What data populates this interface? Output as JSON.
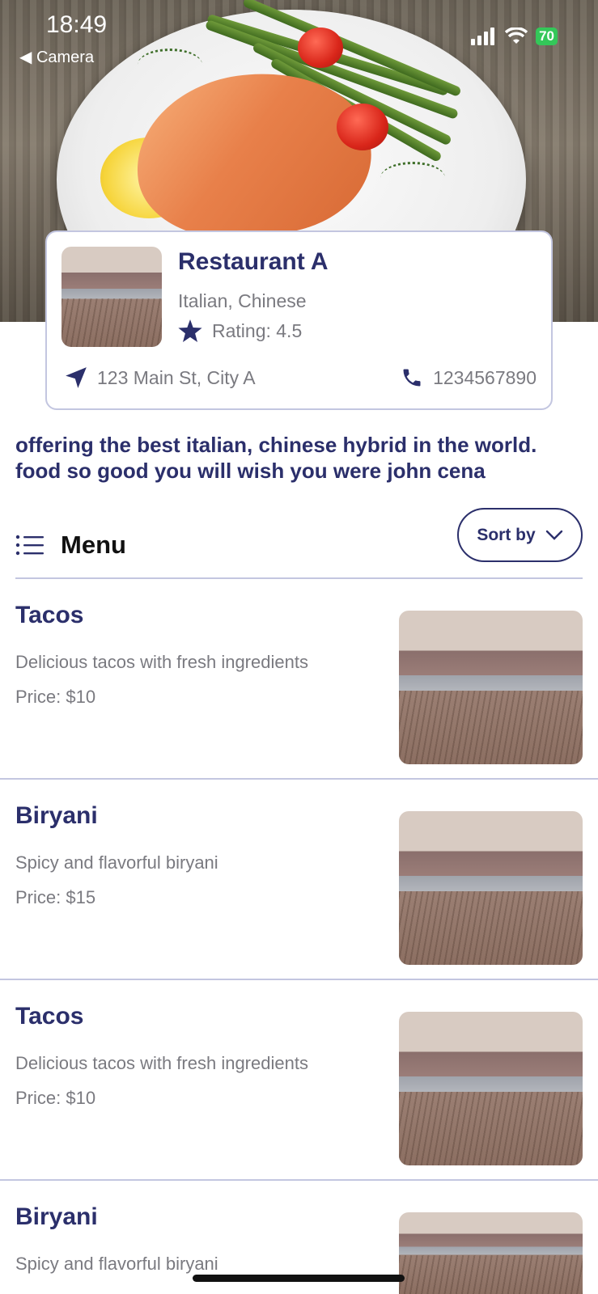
{
  "status_bar": {
    "time": "18:49",
    "back_label": "Camera",
    "battery": "70"
  },
  "restaurant": {
    "name": "Restaurant A",
    "cuisine": "Italian, Chinese",
    "rating": "Rating: 4.5",
    "address": "123 Main St, City A",
    "phone": "1234567890"
  },
  "description": "offering the best italian, chinese hybrid in the world. food so good you will wish you were john cena",
  "menu": {
    "title": "Menu",
    "sort_label": "Sort by"
  },
  "menu_items": [
    {
      "name": "Tacos",
      "description": "Delicious tacos with fresh ingredients",
      "price": "Price: $10"
    },
    {
      "name": "Biryani",
      "description": "Spicy and flavorful biryani",
      "price": "Price: $15"
    },
    {
      "name": "Tacos",
      "description": "Delicious tacos with fresh ingredients",
      "price": "Price: $10"
    },
    {
      "name": "Biryani",
      "description": "Spicy and flavorful biryani",
      "price": ""
    }
  ],
  "colors": {
    "accent": "#2b2f6b",
    "muted_text": "#7a7a80",
    "divider": "#c3c6e0"
  },
  "icons": [
    "back-arrow-icon",
    "signal-icon",
    "wifi-icon",
    "battery-icon",
    "star-icon",
    "location-arrow-icon",
    "phone-icon",
    "list-icon",
    "chevron-down-icon"
  ]
}
